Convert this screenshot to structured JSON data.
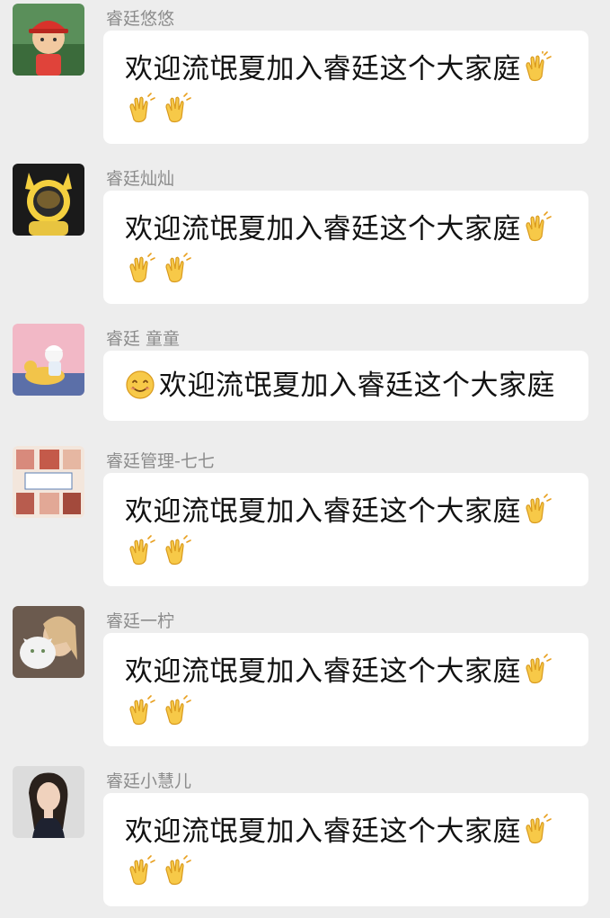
{
  "messages": [
    {
      "sender": "睿廷悠悠",
      "text": "欢迎流氓夏加入睿廷这个大家庭",
      "leading_icon": "",
      "trailing_icons": [
        "clap-icon",
        "clap-icon",
        "clap-icon"
      ],
      "avatar": "avatar-boy-red-cap"
    },
    {
      "sender": "睿廷灿灿",
      "text": "欢迎流氓夏加入睿廷这个大家庭",
      "leading_icon": "",
      "trailing_icons": [
        "clap-icon",
        "clap-icon",
        "clap-icon"
      ],
      "avatar": "avatar-pikachu-astronaut"
    },
    {
      "sender": "睿廷 童童",
      "text": "欢迎流氓夏加入睿廷这个大家庭",
      "leading_icon": "smile-icon",
      "trailing_icons": [],
      "avatar": "avatar-child-on-duck"
    },
    {
      "sender": "睿廷管理-七七",
      "text": "欢迎流氓夏加入睿廷这个大家庭",
      "leading_icon": "",
      "trailing_icons": [
        "clap-icon",
        "clap-icon",
        "clap-icon"
      ],
      "avatar": "avatar-collage"
    },
    {
      "sender": "睿廷一柠",
      "text": "欢迎流氓夏加入睿廷这个大家庭",
      "leading_icon": "",
      "trailing_icons": [
        "clap-icon",
        "clap-icon",
        "clap-icon"
      ],
      "avatar": "avatar-woman-with-cat"
    },
    {
      "sender": "睿廷小慧儿",
      "text": "欢迎流氓夏加入睿廷这个大家庭",
      "leading_icon": "",
      "trailing_icons": [
        "clap-icon",
        "clap-icon",
        "clap-icon"
      ],
      "avatar": "avatar-woman-portrait"
    }
  ],
  "colors": {
    "background": "#ededed",
    "bubble": "#ffffff",
    "sender_name": "#8c8c8c",
    "message_text": "#111111",
    "emoji_yellow": "#f7c948"
  }
}
